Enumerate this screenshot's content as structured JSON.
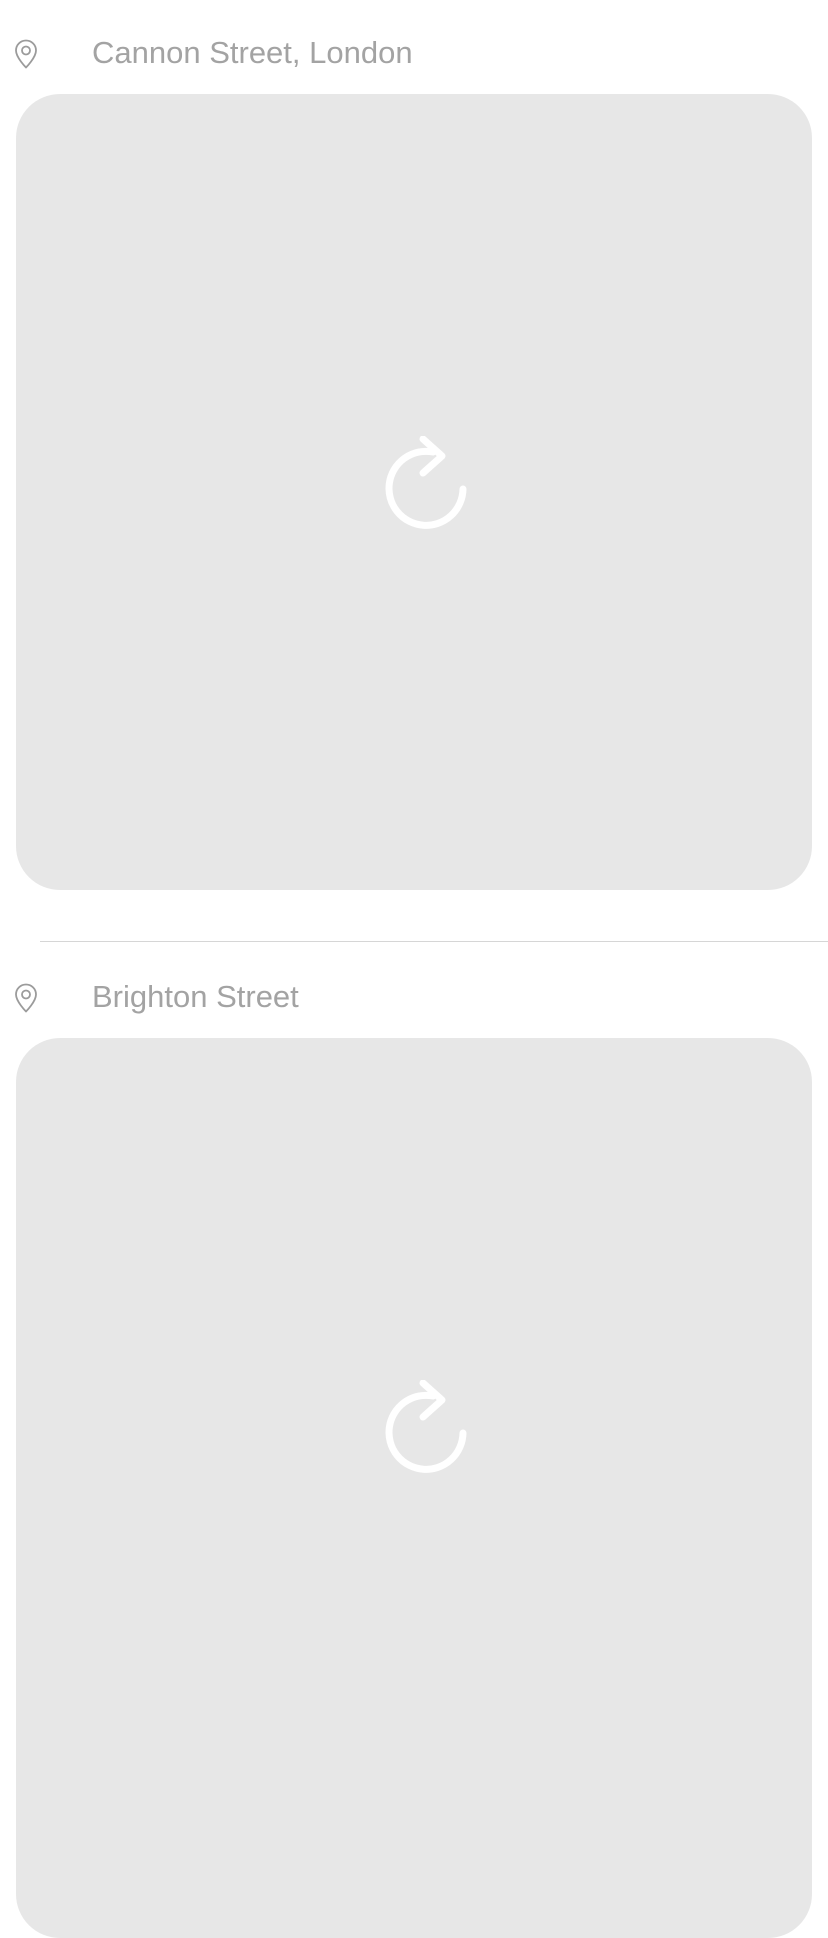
{
  "posts": [
    {
      "location": "Cannon Street, London",
      "location_icon": "map-pin-icon",
      "image_state_icon": "reload-icon"
    },
    {
      "location": "Brighton Street",
      "location_icon": "map-pin-icon",
      "image_state_icon": "reload-icon"
    }
  ],
  "colors": {
    "background": "#ffffff",
    "placeholder": "#e7e7e7",
    "location_text": "#a3a3a3",
    "icon": "#9b9b9b",
    "reload_icon": "#ffffff",
    "divider": "#d6d6d6"
  }
}
